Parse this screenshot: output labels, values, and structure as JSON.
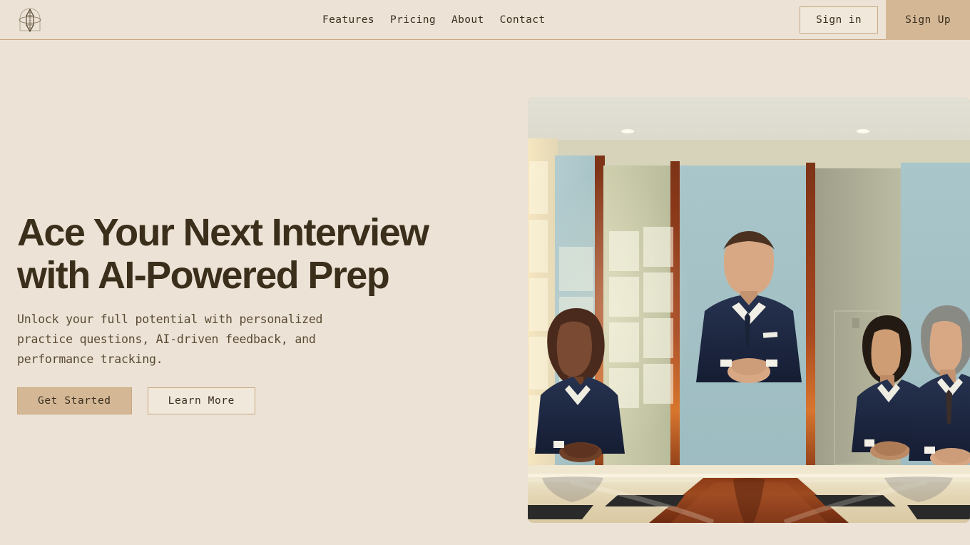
{
  "header": {
    "logo_name": "brand-emblem",
    "nav": [
      {
        "label": "Features"
      },
      {
        "label": "Pricing"
      },
      {
        "label": "About"
      },
      {
        "label": "Contact"
      }
    ],
    "signin_label": "Sign in",
    "signup_label": "Sign Up"
  },
  "hero": {
    "headline": "Ace Your Next Interview\nwith AI-Powered Prep",
    "subheadline": "Unlock your full potential with personalized\npractice questions, AI-driven feedback, and\nperformance tracking.",
    "primary_cta": "Get Started",
    "secondary_cta": "Learn More",
    "image_alt": "boardroom-interview-panel"
  },
  "colors": {
    "page_background": "#ece3d6",
    "header_border": "#c9a882",
    "accent_tan": "#d4b896",
    "text_dark_brown": "#3b2f1c",
    "text_body": "#5a4a33",
    "button_light": "#f0e8da",
    "wall_teal": "#a8c4c8",
    "wall_sage": "#c5c8a8",
    "wood_trim": "#8b3a1e",
    "table_cream": "#e8dcc0",
    "table_mahogany": "#8b3a14",
    "suit_navy": "#1f2a44"
  }
}
